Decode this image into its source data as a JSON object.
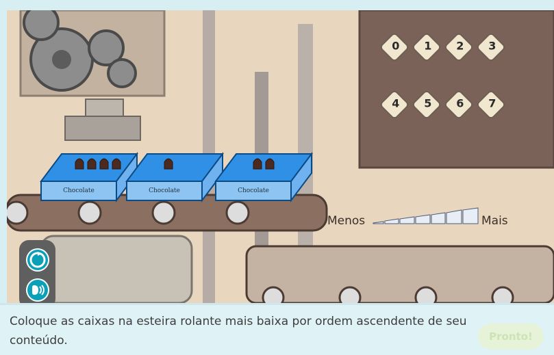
{
  "scene": {
    "legend": {
      "less_label": "Menos",
      "more_label": "Mais"
    },
    "tags": [
      "0",
      "1",
      "2",
      "3",
      "4",
      "5",
      "6",
      "7"
    ],
    "boxes": [
      {
        "label": "Chocolate",
        "items": 4
      },
      {
        "label": "Chocolate",
        "items": 1
      },
      {
        "label": "Chocolate",
        "items": 2
      }
    ]
  },
  "footer": {
    "instruction": "Coloque as caixas na esteira rolante mais baixa por ordem ascendente de seu conteúdo.",
    "ready_button": "Pronto!"
  },
  "controls": {
    "reset_icon": "reset-icon",
    "audio_icon": "audio-icon"
  },
  "colors": {
    "accent": "#0aa0b7",
    "scene_bg": "#e7d2b8",
    "box_blue": "#2f90e6"
  }
}
